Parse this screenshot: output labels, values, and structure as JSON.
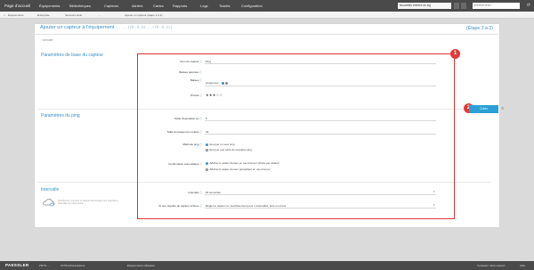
{
  "nav": {
    "home": "Page d'accueil",
    "items": [
      "Équipements",
      "Bibliothèques",
      "Capteurs",
      "Alertes",
      "Cartes",
      "Rapports",
      "Logs",
      "Tickets",
      "Configuration"
    ],
    "notifications": "Nouvelles entrées du log",
    "search_placeholder": "Rechercher..."
  },
  "breadcrumb": [
    "Équipements",
    "Entreprise",
    "Serveurs local",
    "…",
    "Ajouter un capteur (étape 2 à 2)"
  ],
  "header": {
    "title_prefix": "Ajouter un capteur à l'équipement",
    "title_blurred": "…  …rdr-it.io  …rdr-it.io)",
    "step": "(Étape 2 à 2)",
    "back": "Annuler"
  },
  "sections": {
    "basic": "Paramètres de base du capteur",
    "ping": "Paramètres du ping",
    "interval": "Intervalle",
    "interval_desc": "Sélectionnez comment ce capteur doit interagir pour répondre à l'intervalle de l'objet parent"
  },
  "fields": {
    "sensor_name_label": "Nom du capteur",
    "sensor_name_value": "Ping",
    "parent_tags_label": "Balises parentes",
    "tags_label": "Balises",
    "tags_value": "pingsensor",
    "priority_label": "Priorité",
    "priority_stars": "★★★☆☆",
    "timeout_label": "Délai d'expiration (s)",
    "timeout_value": "5",
    "packet_size_label": "Taille du paquet (en octets)",
    "packet_size_value": "32",
    "ping_method_label": "Méthode ping",
    "ping_method_opt1": "Envoyer un seul ping",
    "ping_method_opt2": "Envoyer une série de requêtes ping",
    "auto_ack_label": "Confirmation automatique",
    "auto_ack_opt1": "Afficher le statut d'erreur en cas d'erreur (choisi par défaut)",
    "auto_ack_opt2": "Afficher le statut d'erreur (acquittée) en cas d'erreur",
    "interval_label": "Intervalle",
    "interval_value": "60 secondes",
    "dependency_label": "Si une requête de capteur échoue",
    "dependency_value": "Régler le capteur en avertissement pour 1 intervalles, puis en erreur"
  },
  "actions": {
    "done": "Créer"
  },
  "badges": [
    "1",
    "2"
  ],
  "footer": {
    "brand": "PAESSLER",
    "items": [
      "PRTG …",
      "15:56 Administrateur",
      "Équipements utilisateur",
      "Contacter notre support",
      "Aide"
    ]
  },
  "colors": {
    "accent": "#3b8fc4",
    "highlight": "#dd3333",
    "nav_bg": "#4a4a4a",
    "button": "#2aa0d6"
  }
}
